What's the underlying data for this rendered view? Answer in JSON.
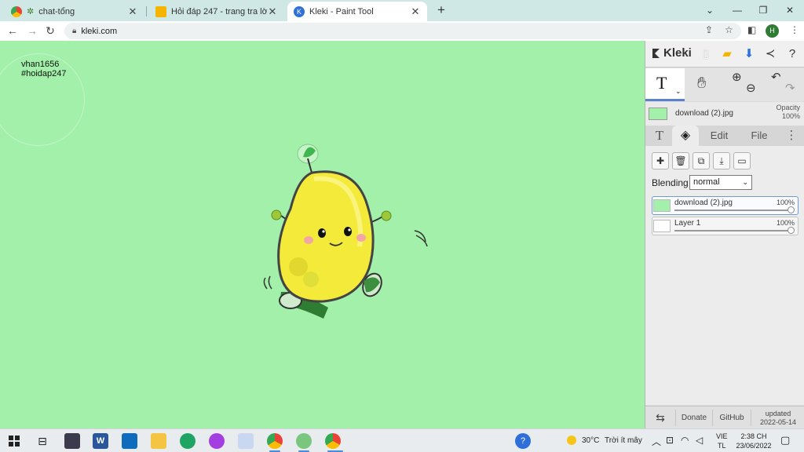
{
  "browser": {
    "tabs": [
      {
        "title": "chat-tổng",
        "active": false
      },
      {
        "title": "Hỏi đáp 247 - trang tra lời",
        "active": false
      },
      {
        "title": "Kleki - Paint Tool",
        "active": true
      }
    ],
    "address": "kleki.com",
    "profile_initial": "H"
  },
  "canvas": {
    "background": "#a2f0a9",
    "text_line1": "vhan1656",
    "text_line2": "#hoidap247"
  },
  "kleki": {
    "logo": "Kleki",
    "layer_name": "download (2).jpg",
    "opacity_label": "Opacity",
    "opacity_value": "100%",
    "tabs": [
      "Edit",
      "File"
    ],
    "blending_label": "Blending",
    "blending_value": "normal",
    "layers": [
      {
        "name": "download (2).jpg",
        "opacity": "100%",
        "active": true
      },
      {
        "name": "Layer 1",
        "opacity": "100%",
        "active": false
      }
    ],
    "footer": {
      "donate": "Donate",
      "github": "GitHub",
      "updated_label": "updated",
      "updated_date": "2022-05-14"
    }
  },
  "taskbar": {
    "weather_temp": "30°C",
    "weather_desc": "Trời ít mây",
    "lang_line1": "VIE",
    "lang_line2": "TL",
    "time": "2:38 CH",
    "date": "23/06/2022"
  },
  "colors": {
    "canvas_green": "#a2f0a9",
    "mango_yellow": "#f3ea3a",
    "accent_blue": "#5a82c8"
  }
}
